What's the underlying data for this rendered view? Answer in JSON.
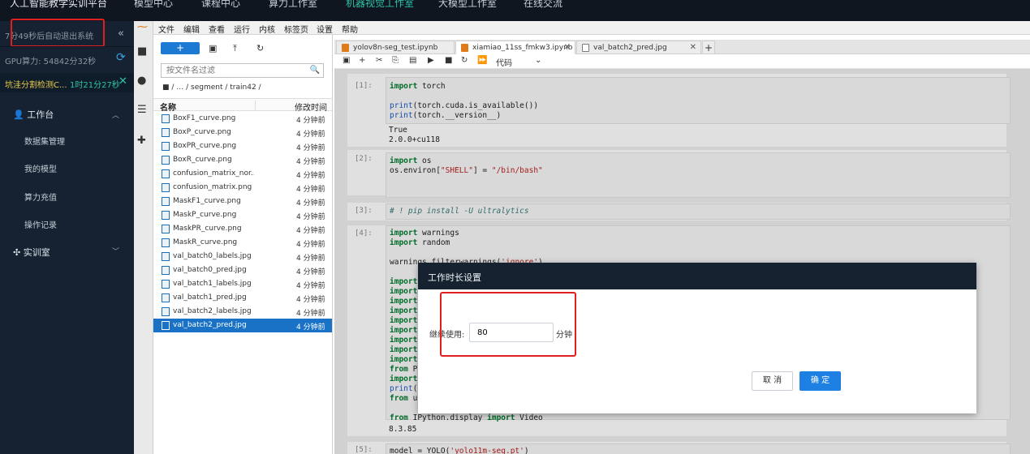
{
  "topnav": {
    "brand": "人工智能教学实训平台",
    "items": [
      "模型中心",
      "课程中心",
      "算力工作室",
      "机器视觉工作室",
      "大模型工作室",
      "在线交流"
    ],
    "active_index": 3
  },
  "sidebar": {
    "timer_text": "7分49秒后自动退出系统",
    "gpu_text": "GPU算力: 54842分32秒",
    "task": {
      "name": "坑洼分割检测C...",
      "time": "1时21分27秒"
    },
    "workbench_label": "工作台",
    "workbench_items": [
      "数据集管理",
      "我的模型",
      "算力充值",
      "操作记录"
    ],
    "lab_label": "实训室"
  },
  "jupyter_menu": [
    "文件",
    "编辑",
    "查看",
    "运行",
    "内核",
    "标签页",
    "设置",
    "帮助"
  ],
  "filebrowser": {
    "new_label": "+",
    "filter_placeholder": "按文件名过滤",
    "breadcrumb": "/ … / segment / train42 /",
    "col_name": "名称",
    "col_modified": "修改时间",
    "files": [
      {
        "name": "BoxF1_curve.png",
        "modified": "4 分钟前"
      },
      {
        "name": "BoxP_curve.png",
        "modified": "4 分钟前"
      },
      {
        "name": "BoxPR_curve.png",
        "modified": "4 分钟前"
      },
      {
        "name": "BoxR_curve.png",
        "modified": "4 分钟前"
      },
      {
        "name": "confusion_matrix_nor...",
        "modified": "4 分钟前"
      },
      {
        "name": "confusion_matrix.png",
        "modified": "4 分钟前"
      },
      {
        "name": "MaskF1_curve.png",
        "modified": "4 分钟前"
      },
      {
        "name": "MaskP_curve.png",
        "modified": "4 分钟前"
      },
      {
        "name": "MaskPR_curve.png",
        "modified": "4 分钟前"
      },
      {
        "name": "MaskR_curve.png",
        "modified": "4 分钟前"
      },
      {
        "name": "val_batch0_labels.jpg",
        "modified": "4 分钟前"
      },
      {
        "name": "val_batch0_pred.jpg",
        "modified": "4 分钟前"
      },
      {
        "name": "val_batch1_labels.jpg",
        "modified": "4 分钟前"
      },
      {
        "name": "val_batch1_pred.jpg",
        "modified": "4 分钟前"
      },
      {
        "name": "val_batch2_labels.jpg",
        "modified": "4 分钟前"
      },
      {
        "name": "val_batch2_pred.jpg",
        "modified": "4 分钟前"
      }
    ],
    "selected_index": 15
  },
  "tabs": [
    "yolov8n-seg_test.ipynb",
    "xiamiao_11ss_fmkw3.ipynb",
    "val_batch2_pred.jpg"
  ],
  "active_tab": 1,
  "notebook": {
    "cell_type": "代码",
    "prompts": [
      "[1]:",
      "[2]:",
      "[3]:",
      "[4]:",
      "[5]:"
    ],
    "out1": [
      "True",
      "2.0.0+cu118"
    ],
    "out4": "8.3.85"
  },
  "dialog": {
    "title": "工作时长设置",
    "label": "继续使用:",
    "value": "80",
    "unit": "分钟",
    "cancel": "取 消",
    "ok": "确 定"
  },
  "colors": {
    "accent": "#2ec3a8",
    "primary": "#1e80e2",
    "highlight_box": "#e01f1f"
  }
}
